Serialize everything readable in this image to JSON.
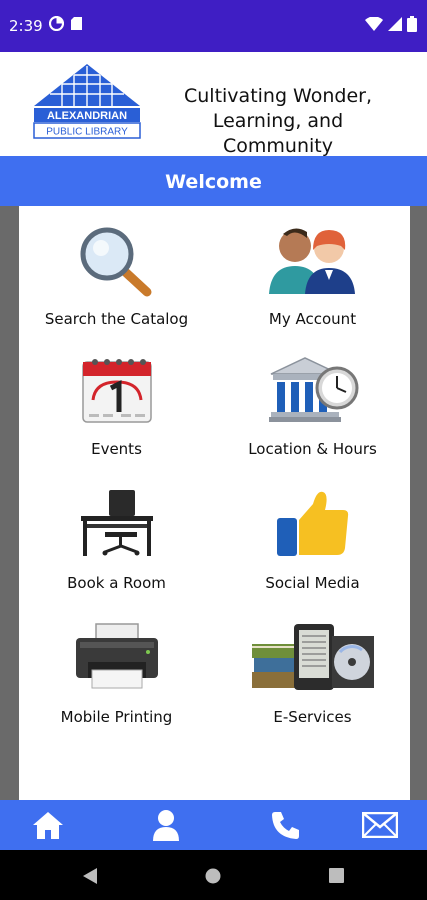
{
  "status_bar": {
    "time": "2:39",
    "icons": [
      "data-saver-icon",
      "sd-card-icon",
      "wifi-icon",
      "signal-icon",
      "battery-icon"
    ]
  },
  "header": {
    "logo": {
      "name": "ALEXANDRIAN",
      "sub": "PUBLIC LIBRARY"
    },
    "tagline_line1": "Cultivating Wonder,",
    "tagline_line2": "Learning, and Community"
  },
  "welcome": "Welcome",
  "tiles": [
    {
      "label": "Search the Catalog",
      "icon": "magnifier-icon"
    },
    {
      "label": "My Account",
      "icon": "people-icon"
    },
    {
      "label": "Events",
      "icon": "calendar-icon"
    },
    {
      "label": "Location & Hours",
      "icon": "building-clock-icon"
    },
    {
      "label": "Book a Room",
      "icon": "desk-chair-icon"
    },
    {
      "label": "Social Media",
      "icon": "thumbs-up-icon"
    },
    {
      "label": "Mobile Printing",
      "icon": "printer-icon"
    },
    {
      "label": "E-Services",
      "icon": "ereader-icon"
    }
  ],
  "bottom_nav": [
    "home-icon",
    "person-icon",
    "phone-icon",
    "mail-icon"
  ],
  "colors": {
    "status_bar": "#3f1ec4",
    "accent": "#3f6ff0",
    "logo_blue": "#2a5fd6"
  }
}
